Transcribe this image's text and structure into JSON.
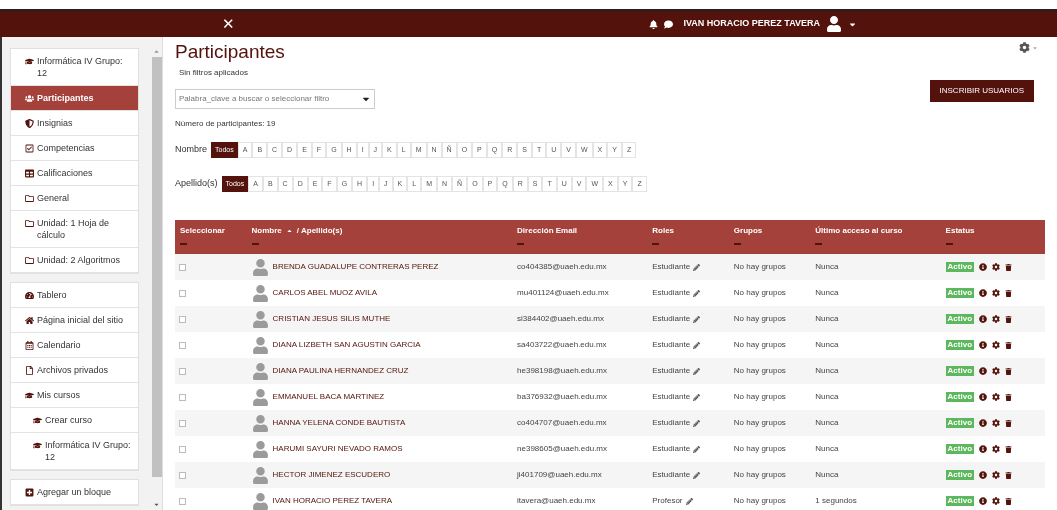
{
  "top_bar": {
    "close_glyph": "✕",
    "user_name": "IVAN HORACIO PEREZ TAVERA"
  },
  "sidebar": {
    "groups": [
      {
        "items": [
          {
            "label": "Informática IV Grupo: 12",
            "selected": false
          },
          {
            "label": "Participantes",
            "selected": true
          },
          {
            "label": "Insignias",
            "selected": false
          },
          {
            "label": "Competencias",
            "selected": false
          },
          {
            "label": "Calificaciones",
            "selected": false
          },
          {
            "label": "General",
            "selected": false
          },
          {
            "label": "Unidad: 1 Hoja de cálculo",
            "selected": false
          },
          {
            "label": "Unidad: 2 Algoritmos",
            "selected": false
          }
        ]
      },
      {
        "items": [
          {
            "label": "Tablero",
            "selected": false
          },
          {
            "label": "Página inicial del sitio",
            "selected": false
          },
          {
            "label": "Calendario",
            "selected": false
          },
          {
            "label": "Archivos privados",
            "selected": false
          },
          {
            "label": "Mis cursos",
            "selected": false,
            "children": [
              {
                "label": "Crear curso",
                "selected": false
              },
              {
                "label": "Informática IV Grupo: 12",
                "selected": false
              }
            ]
          }
        ]
      },
      {
        "items": [
          {
            "label": "Agregar un bloque",
            "selected": false
          }
        ]
      }
    ]
  },
  "page": {
    "title": "Participantes",
    "filters_note": "Sin filtros aplicados",
    "filter_placeholder": "Palabra_clave a buscar o seleccionar filtro",
    "enrol_button": "INSCRIBIR USUARIOS",
    "count": "Número de participantes: 19"
  },
  "initials_bars": [
    {
      "label": "Nombre",
      "letters": [
        {
          "label": "Todos",
          "selected": true
        },
        {
          "label": "A",
          "selected": false
        },
        {
          "label": "B",
          "selected": false
        },
        {
          "label": "C",
          "selected": false
        },
        {
          "label": "D",
          "selected": false
        },
        {
          "label": "E",
          "selected": false
        },
        {
          "label": "F",
          "selected": false
        },
        {
          "label": "G",
          "selected": false
        },
        {
          "label": "H",
          "selected": false
        },
        {
          "label": "I",
          "selected": false
        },
        {
          "label": "J",
          "selected": false
        },
        {
          "label": "K",
          "selected": false
        },
        {
          "label": "L",
          "selected": false
        },
        {
          "label": "M",
          "selected": false
        },
        {
          "label": "N",
          "selected": false
        },
        {
          "label": "Ñ",
          "selected": false
        },
        {
          "label": "O",
          "selected": false
        },
        {
          "label": "P",
          "selected": false
        },
        {
          "label": "Q",
          "selected": false
        },
        {
          "label": "R",
          "selected": false
        },
        {
          "label": "S",
          "selected": false
        },
        {
          "label": "T",
          "selected": false
        },
        {
          "label": "U",
          "selected": false
        },
        {
          "label": "V",
          "selected": false
        },
        {
          "label": "W",
          "selected": false
        },
        {
          "label": "X",
          "selected": false
        },
        {
          "label": "Y",
          "selected": false
        },
        {
          "label": "Z",
          "selected": false
        }
      ]
    },
    {
      "label": "Apellido(s)",
      "letters": [
        {
          "label": "Todos",
          "selected": true
        },
        {
          "label": "A",
          "selected": false
        },
        {
          "label": "B",
          "selected": false
        },
        {
          "label": "C",
          "selected": false
        },
        {
          "label": "D",
          "selected": false
        },
        {
          "label": "E",
          "selected": false
        },
        {
          "label": "F",
          "selected": false
        },
        {
          "label": "G",
          "selected": false
        },
        {
          "label": "H",
          "selected": false
        },
        {
          "label": "I",
          "selected": false
        },
        {
          "label": "J",
          "selected": false
        },
        {
          "label": "K",
          "selected": false
        },
        {
          "label": "L",
          "selected": false
        },
        {
          "label": "M",
          "selected": false
        },
        {
          "label": "N",
          "selected": false
        },
        {
          "label": "Ñ",
          "selected": false
        },
        {
          "label": "O",
          "selected": false
        },
        {
          "label": "P",
          "selected": false
        },
        {
          "label": "Q",
          "selected": false
        },
        {
          "label": "R",
          "selected": false
        },
        {
          "label": "S",
          "selected": false
        },
        {
          "label": "T",
          "selected": false
        },
        {
          "label": "U",
          "selected": false
        },
        {
          "label": "V",
          "selected": false
        },
        {
          "label": "W",
          "selected": false
        },
        {
          "label": "X",
          "selected": false
        },
        {
          "label": "Y",
          "selected": false
        },
        {
          "label": "Z",
          "selected": false
        }
      ]
    }
  ],
  "table": {
    "columns": [
      {
        "label": "Seleccionar"
      },
      {
        "label": "Nombre",
        "sorted": true,
        "extra": "/ Apellido(s)"
      },
      {
        "label": "Dirección Email"
      },
      {
        "label": "Roles"
      },
      {
        "label": "Grupos"
      },
      {
        "label": "Último acceso al curso"
      },
      {
        "label": "Estatus"
      }
    ],
    "rows": [
      {
        "checked": false,
        "name": "BRENDA GUADALUPE CONTRERAS PEREZ",
        "email": "co404385@uaeh.edu.mx",
        "role": "Estudiante",
        "groups": "No hay grupos",
        "last_access": "Nunca",
        "status": "Activo"
      },
      {
        "checked": false,
        "name": "CARLOS ABEL MUOZ AVILA",
        "email": "mu401124@uaeh.edu.mx",
        "role": "Estudiante",
        "groups": "No hay grupos",
        "last_access": "Nunca",
        "status": "Activo"
      },
      {
        "checked": false,
        "name": "CRISTIAN JESUS SILIS MUTHE",
        "email": "si384402@uaeh.edu.mx",
        "role": "Estudiante",
        "groups": "No hay grupos",
        "last_access": "Nunca",
        "status": "Activo"
      },
      {
        "checked": false,
        "name": "DIANA LIZBETH SAN AGUSTIN GARCIA",
        "email": "sa403722@uaeh.edu.mx",
        "role": "Estudiante",
        "groups": "No hay grupos",
        "last_access": "Nunca",
        "status": "Activo"
      },
      {
        "checked": false,
        "name": "DIANA PAULINA HERNANDEZ CRUZ",
        "email": "he398198@uaeh.edu.mx",
        "role": "Estudiante",
        "groups": "No hay grupos",
        "last_access": "Nunca",
        "status": "Activo"
      },
      {
        "checked": false,
        "name": "EMMANUEL BACA MARTINEZ",
        "email": "ba376932@uaeh.edu.mx",
        "role": "Estudiante",
        "groups": "No hay grupos",
        "last_access": "Nunca",
        "status": "Activo"
      },
      {
        "checked": false,
        "name": "HANNA YELENA CONDE BAUTISTA",
        "email": "co404707@uaeh.edu.mx",
        "role": "Estudiante",
        "groups": "No hay grupos",
        "last_access": "Nunca",
        "status": "Activo"
      },
      {
        "checked": false,
        "name": "HARUMI SAYURI NEVADO RAMOS",
        "email": "ne398605@uaeh.edu.mx",
        "role": "Estudiante",
        "groups": "No hay grupos",
        "last_access": "Nunca",
        "status": "Activo"
      },
      {
        "checked": false,
        "name": "HECTOR JIMENEZ ESCUDERO",
        "email": "ji401709@uaeh.edu.mx",
        "role": "Estudiante",
        "groups": "No hay grupos",
        "last_access": "Nunca",
        "status": "Activo"
      },
      {
        "checked": false,
        "name": "IVAN HORACIO PEREZ TAVERA",
        "email": "itavera@uaeh.edu.mx",
        "role": "Profesor",
        "groups": "No hay grupos",
        "last_access": "1 segundos",
        "status": "Activo"
      }
    ]
  }
}
